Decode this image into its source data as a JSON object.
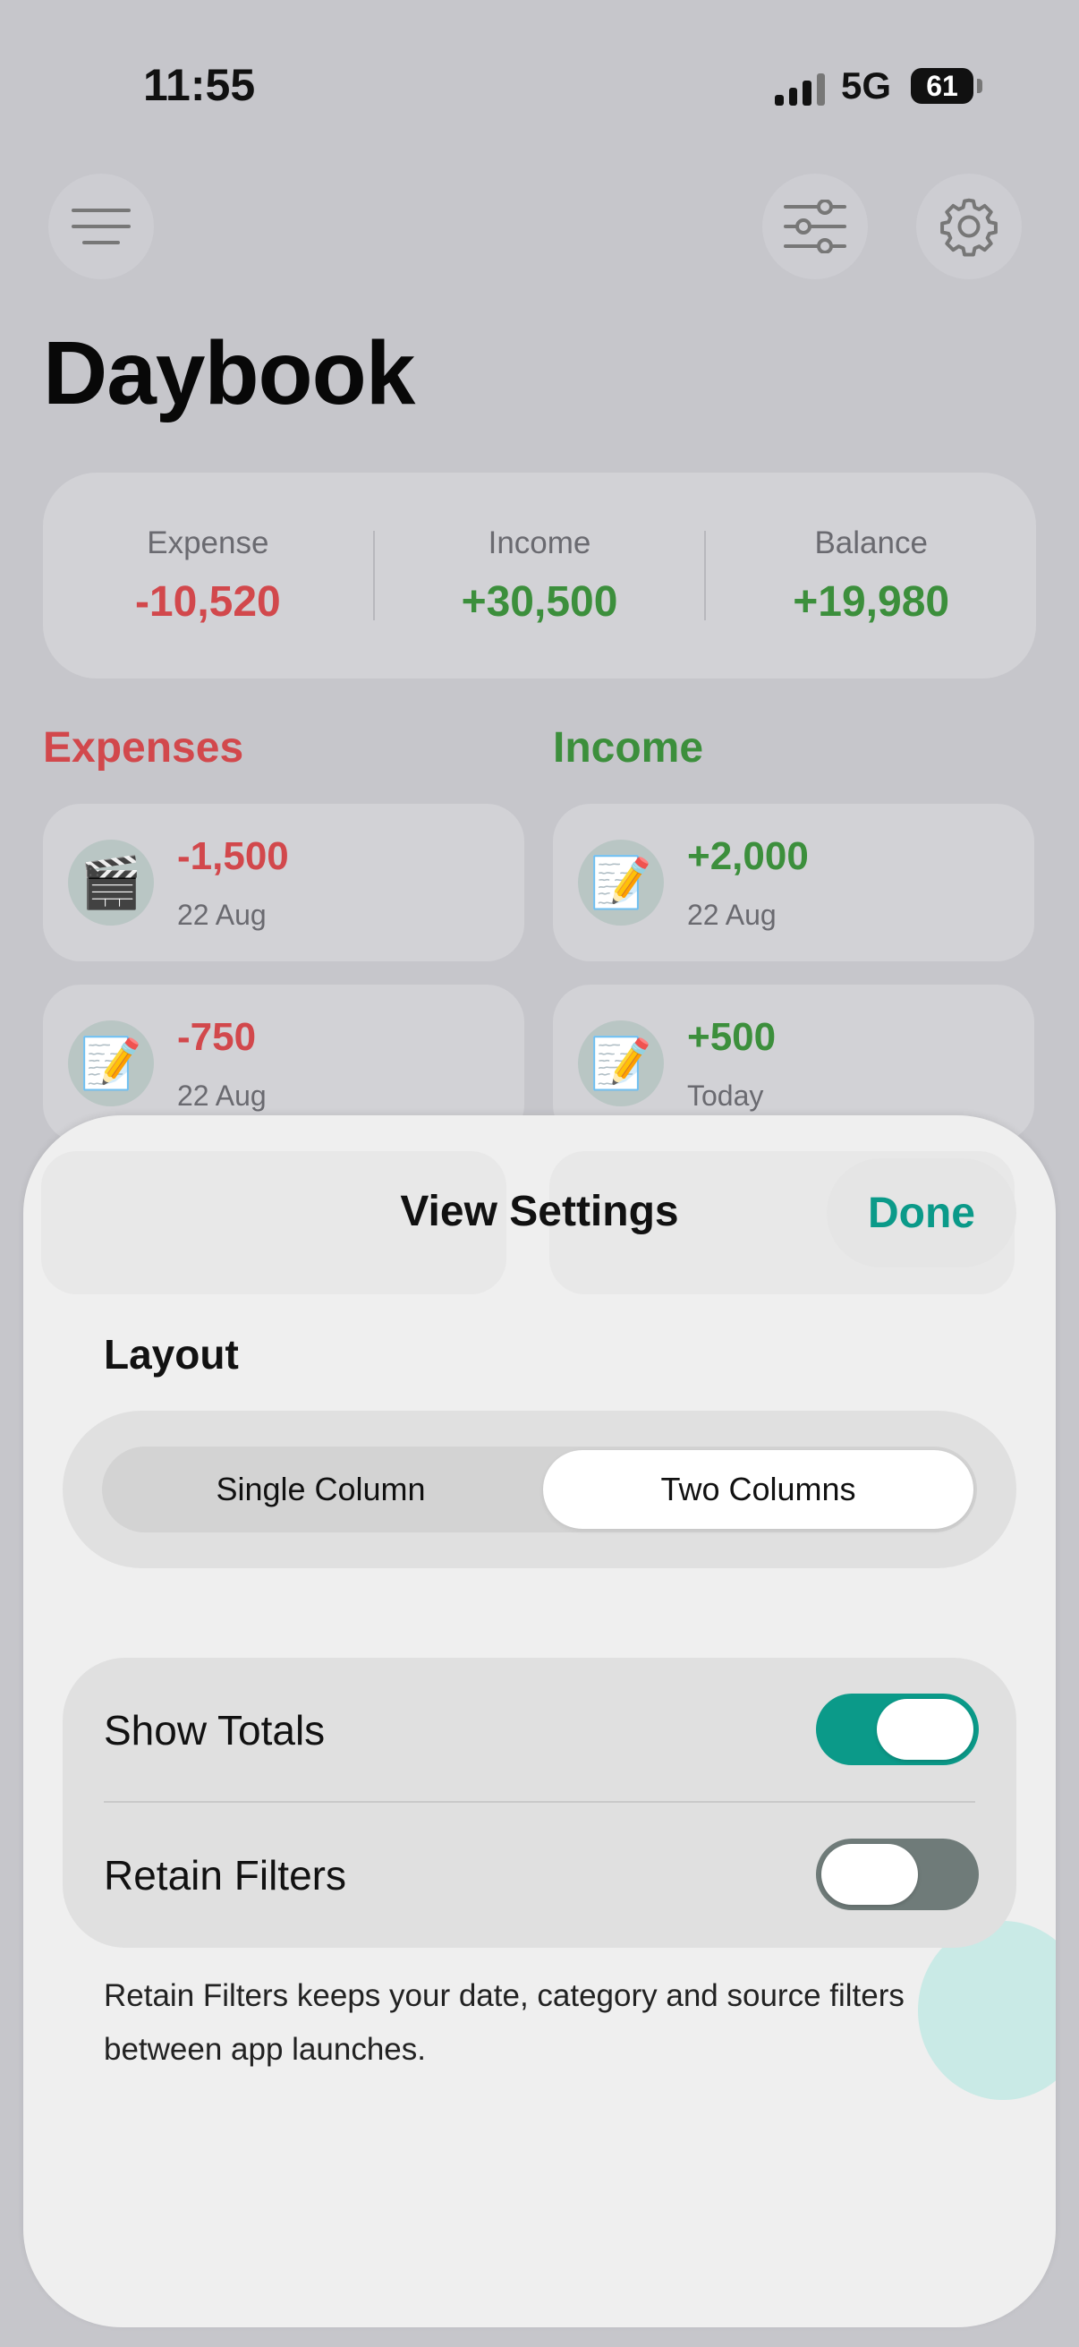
{
  "status_bar": {
    "time": "11:55",
    "network": "5G",
    "battery": "61"
  },
  "header": {
    "menu_icon": "menu-icon",
    "filter_icon": "sliders-icon",
    "settings_icon": "gear-icon",
    "title": "Daybook"
  },
  "summary": {
    "expense": {
      "label": "Expense",
      "value": "-10,520"
    },
    "income": {
      "label": "Income",
      "value": "+30,500"
    },
    "balance": {
      "label": "Balance",
      "value": "+19,980"
    }
  },
  "sections": {
    "expenses_title": "Expenses",
    "income_title": "Income"
  },
  "expenses": [
    {
      "icon": "🎬",
      "amount": "-1,500",
      "date": "22 Aug"
    },
    {
      "icon": "📝",
      "amount": "-750",
      "date": "22 Aug"
    }
  ],
  "income": [
    {
      "icon": "📝",
      "amount": "+2,000",
      "date": "22 Aug"
    },
    {
      "icon": "📝",
      "amount": "+500",
      "date": "Today"
    }
  ],
  "sheet": {
    "title": "View Settings",
    "done_label": "Done",
    "layout_label": "Layout",
    "layout_options": [
      "Single Column",
      "Two Columns"
    ],
    "layout_selected": "Two Columns",
    "toggles": [
      {
        "label": "Show Totals",
        "on": true
      },
      {
        "label": "Retain Filters",
        "on": false
      }
    ],
    "footnote": "Retain Filters keeps your date, category and source filters between app launches."
  },
  "colors": {
    "expense": "#d2484c",
    "income": "#3c8f3c",
    "accent": "#0b9a89",
    "toggle_off": "#6f7b79"
  }
}
